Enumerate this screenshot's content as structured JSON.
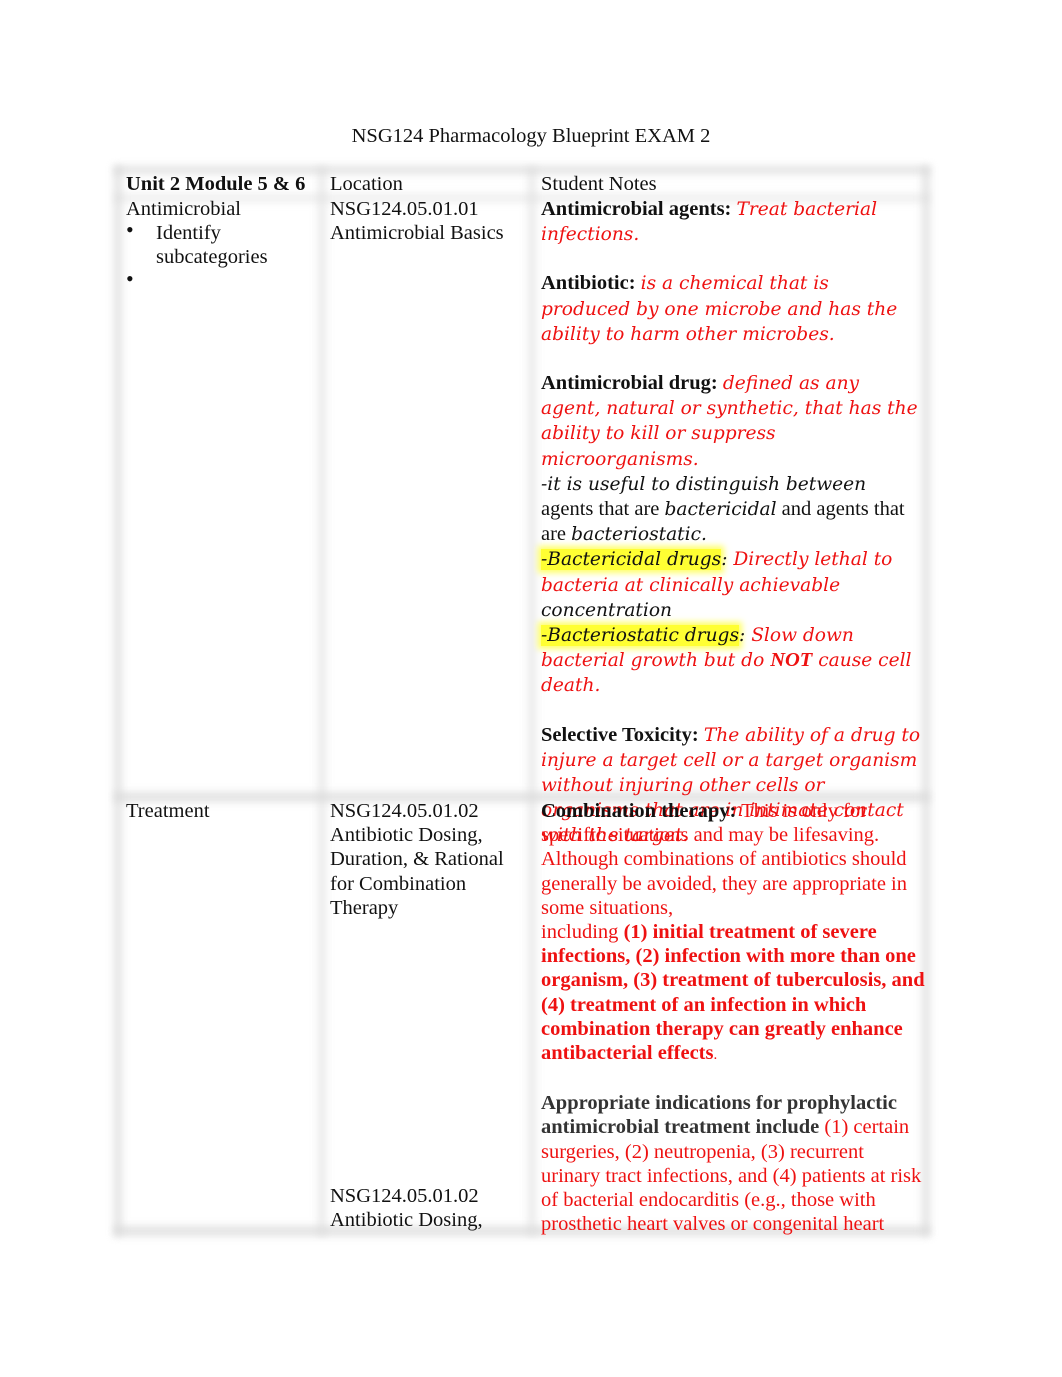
{
  "document": {
    "title": "NSG124 Pharmacology Blueprint EXAM 2"
  },
  "table": {
    "headers": {
      "unit": "Unit 2 Module 5 & 6",
      "location": "Location",
      "notes": "Student Notes"
    },
    "rows": [
      {
        "topic": "Antimicrobial",
        "bullets": [
          "Identify subcategories",
          ""
        ],
        "location_code": "NSG124.05.01.01",
        "location_title": "Antimicrobial Basics",
        "notes": {
          "agents_label": "Antimicrobial agents:",
          "agents_text": "Treat bacterial infections.",
          "antibiotic_label": "Antibiotic:",
          "antibiotic_text": "is a chemical that is produced by one microbe and has the ability to harm other microbes.",
          "drug_label": "Antimicrobial drug:",
          "drug_text": "defined as any agent, natural or synthetic, that has the ability to kill or suppress microorganisms.",
          "distinguish_1": "-it is useful to distinguish between",
          "distinguish_2": " agents that are ",
          "distinguish_3": "bactericidal",
          "distinguish_4": " and agents that are ",
          "distinguish_5": "bacteriostatic",
          "distinguish_6": ".",
          "bactericidal_label": "-Bactericidal drugs",
          "bactericidal_colon": ":",
          "bactericidal_text": " Directly lethal to bacteria at clinically achievable",
          "bactericidal_tail": "concentration",
          "bacteriostatic_label": "-Bacteriostatic drugs",
          "bacteriostatic_colon": ":",
          "bacteriostatic_text_1": " Slow down bacterial growth but do ",
          "bacteriostatic_not": "NOT",
          "bacteriostatic_text_2": " cause cell death.",
          "toxicity_label": "Selective Toxicity:",
          "toxicity_text": "The ability of a drug to injure a target cell or a target organism without injuring other cells or organisms that are in intimate contact with the target."
        }
      },
      {
        "topic": "Treatment",
        "location_code": "NSG124.05.01.02",
        "location_title": "Antibiotic Dosing, Duration, & Rational for Combination Therapy",
        "location_code_2": "NSG124.05.01.02",
        "location_title_2": "Antibiotic Dosing,",
        "notes": {
          "combo_label": "Combination therapy:",
          "combo_text": " This is only for specific situations and may be lifesaving. Although combinations of antibiotics should generally be avoided, they are appropriate in some situations,",
          "combo_including": "including ",
          "combo_list": "(1) initial treatment of severe infections, (2) infection with more than one organism, (3) treatment of tuberculosis, and (4) treatment of an infection in which combination therapy can greatly enhance antibacterial effects",
          "combo_end": ".",
          "prophylactic_label": "Appropriate indications for prophylactic antimicrobial treatment include",
          "prophylactic_text": " (1) certain surgeries, (2) neutropenia, (3) recurrent urinary tract infections, and (4) patients at risk of bacterial endocarditis (e.g., those with prosthetic heart valves or congenital heart"
        }
      }
    ]
  },
  "colors": {
    "accent_red": "#ee1111",
    "highlight": "#ffff33",
    "subheading_gray": "#333333"
  }
}
